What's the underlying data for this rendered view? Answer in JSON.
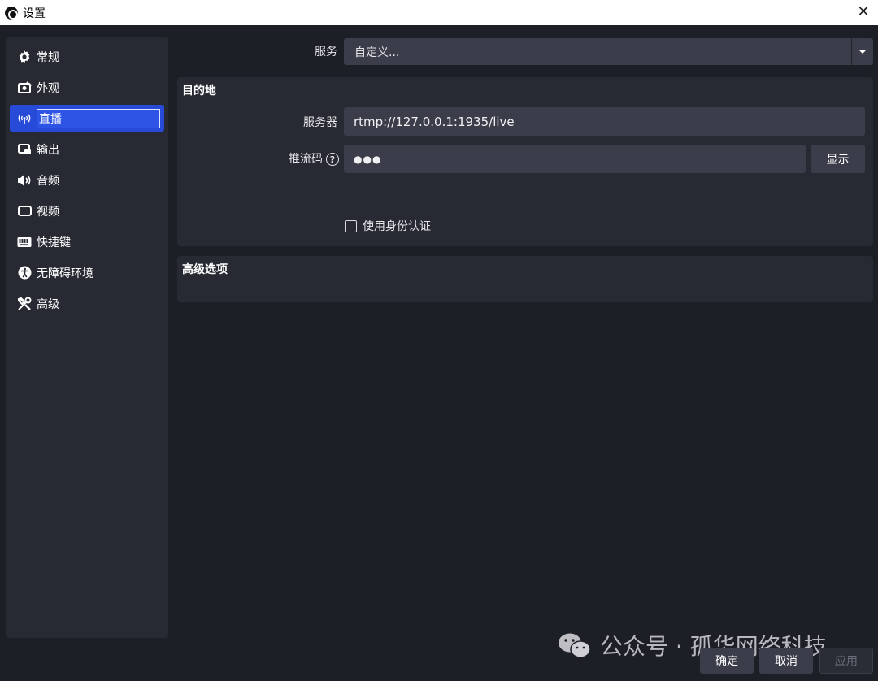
{
  "window": {
    "title": "设置",
    "close_glyph": "✕"
  },
  "sidebar": {
    "items": [
      {
        "label": "常规",
        "icon": "gear-icon"
      },
      {
        "label": "外观",
        "icon": "palette-icon"
      },
      {
        "label": "直播",
        "icon": "broadcast-icon",
        "active": true
      },
      {
        "label": "输出",
        "icon": "output-icon"
      },
      {
        "label": "音频",
        "icon": "speaker-icon"
      },
      {
        "label": "视频",
        "icon": "monitor-icon"
      },
      {
        "label": "快捷键",
        "icon": "keyboard-icon"
      },
      {
        "label": "无障碍环境",
        "icon": "accessibility-icon"
      },
      {
        "label": "高级",
        "icon": "tools-icon"
      }
    ]
  },
  "service": {
    "label": "服务",
    "value": "自定义..."
  },
  "destination": {
    "title": "目的地",
    "server_label": "服务器",
    "server_value": "rtmp://127.0.0.1:1935/live",
    "stream_key_label": "推流码",
    "stream_key_value": "●●●",
    "show_button": "显示",
    "auth_checkbox_label": "使用身份认证",
    "auth_checked": false
  },
  "advanced": {
    "title": "高级选项"
  },
  "footer": {
    "ok": "确定",
    "cancel": "取消",
    "apply": "应用"
  },
  "watermark": {
    "text": "公众号 · 孤华网络科技"
  }
}
